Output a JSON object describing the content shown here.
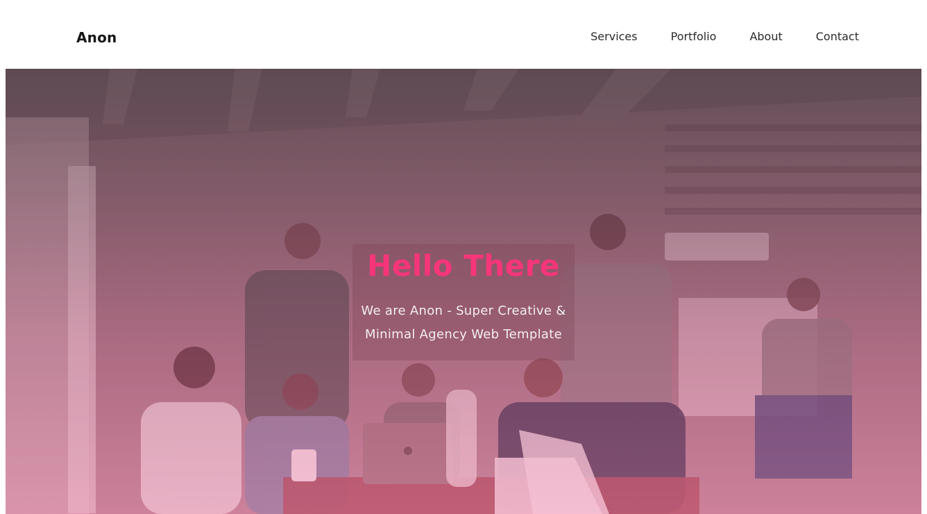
{
  "header": {
    "logo": "Anon",
    "nav": [
      {
        "label": "Services"
      },
      {
        "label": "Portfolio"
      },
      {
        "label": "About"
      },
      {
        "label": "Contact"
      }
    ]
  },
  "hero": {
    "title": "Hello There",
    "subtitle_line1": "We are Anon - Super Creative &",
    "subtitle_line2": "Minimal Agency Web Template",
    "title_color": "#f7357a",
    "overlay_color": "#e0457e",
    "background_image": "team-meeting-photo"
  }
}
